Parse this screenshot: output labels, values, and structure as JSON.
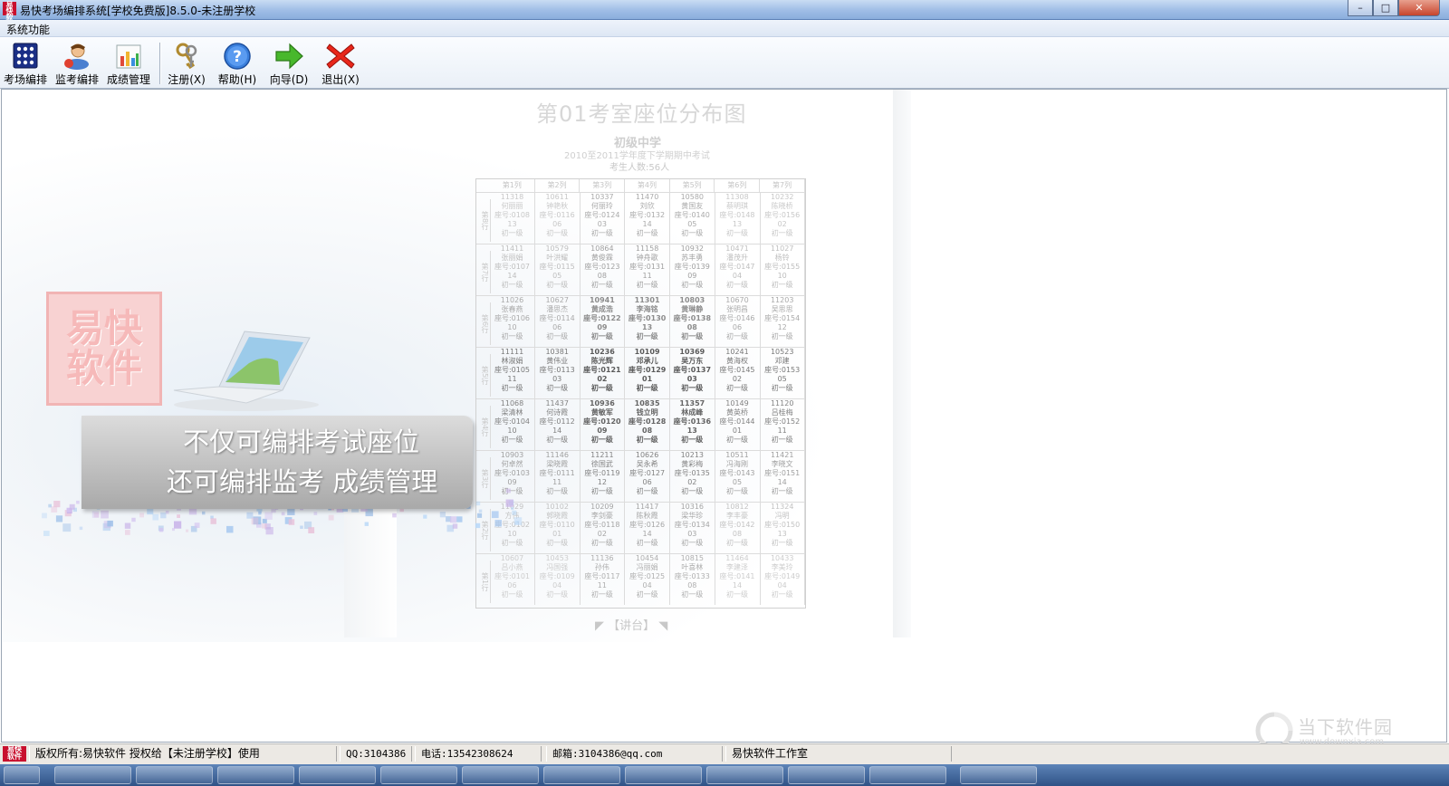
{
  "window": {
    "title": "易快考场编排系统[学校免费版]8.5.0-未注册学校",
    "app_icon_text": "易快软件",
    "controls": {
      "minimize": "–",
      "maximize": "□",
      "close": "✕"
    }
  },
  "menubar": {
    "items": [
      {
        "label": "系统功能"
      }
    ]
  },
  "toolbar": {
    "buttons": [
      {
        "label": "考场编排",
        "icon": "exam-grid-icon"
      },
      {
        "label": "监考编排",
        "icon": "proctor-person-icon"
      },
      {
        "label": "成绩管理",
        "icon": "bar-chart-icon"
      },
      {
        "label": "注册(X)",
        "icon": "keys-icon"
      },
      {
        "label": "帮助(H)",
        "icon": "help-icon"
      },
      {
        "label": "向导(D)",
        "icon": "green-arrow-icon"
      },
      {
        "label": "退出(X)",
        "icon": "red-x-icon"
      }
    ]
  },
  "splash": {
    "seating_chart": {
      "title": "第01考室座位分布图",
      "school": "初级中学",
      "exam": "2010至2011学年度下学期期中考试",
      "count": "考生人数:56人",
      "columns": [
        "第1列",
        "第2列",
        "第3列",
        "第4列",
        "第5列",
        "第6列",
        "第7列"
      ],
      "rows": [
        {
          "label": "第8行",
          "seats": [
            {
              "id": "11318",
              "name": "何丽丽",
              "seat": "座号:0108",
              "room": "13",
              "grade": "初一级"
            },
            {
              "id": "10611",
              "name": "钟艳秋",
              "seat": "座号:0116",
              "room": "06",
              "grade": "初一级"
            },
            {
              "id": "10337",
              "name": "何丽玲",
              "seat": "座号:0124",
              "room": "03",
              "grade": "初一级"
            },
            {
              "id": "11470",
              "name": "刘欣",
              "seat": "座号:0132",
              "room": "14",
              "grade": "初一级"
            },
            {
              "id": "10580",
              "name": "黄国友",
              "seat": "座号:0140",
              "room": "05",
              "grade": "初一级"
            },
            {
              "id": "11308",
              "name": "蔡明琪",
              "seat": "座号:0148",
              "room": "13",
              "grade": "初一级"
            },
            {
              "id": "10232",
              "name": "陈晓桥",
              "seat": "座号:0156",
              "room": "02",
              "grade": "初一级"
            }
          ]
        },
        {
          "label": "第7行",
          "seats": [
            {
              "id": "11411",
              "name": "张丽娟",
              "seat": "座号:0107",
              "room": "14",
              "grade": "初一级"
            },
            {
              "id": "10579",
              "name": "叶洪耀",
              "seat": "座号:0115",
              "room": "05",
              "grade": "初一级"
            },
            {
              "id": "10864",
              "name": "黄俊霖",
              "seat": "座号:0123",
              "room": "08",
              "grade": "初一级"
            },
            {
              "id": "11158",
              "name": "钟舟歌",
              "seat": "座号:0131",
              "room": "11",
              "grade": "初一级"
            },
            {
              "id": "10932",
              "name": "苏丰勇",
              "seat": "座号:0139",
              "room": "09",
              "grade": "初一级"
            },
            {
              "id": "10471",
              "name": "潘茂升",
              "seat": "座号:0147",
              "room": "04",
              "grade": "初一级"
            },
            {
              "id": "11027",
              "name": "杨铃",
              "seat": "座号:0155",
              "room": "10",
              "grade": "初一级"
            }
          ]
        },
        {
          "label": "第6行",
          "seats": [
            {
              "id": "11026",
              "name": "张春燕",
              "seat": "座号:0106",
              "room": "10",
              "grade": "初一级"
            },
            {
              "id": "10627",
              "name": "潘思杰",
              "seat": "座号:0114",
              "room": "06",
              "grade": "初一级"
            },
            {
              "id": "10941",
              "name": "黄成浩",
              "seat": "座号:0122",
              "room": "09",
              "grade": "初一级"
            },
            {
              "id": "11301",
              "name": "李海铭",
              "seat": "座号:0130",
              "room": "13",
              "grade": "初一级"
            },
            {
              "id": "10803",
              "name": "黄琳静",
              "seat": "座号:0138",
              "room": "08",
              "grade": "初一级"
            },
            {
              "id": "10670",
              "name": "张明昌",
              "seat": "座号:0146",
              "room": "06",
              "grade": "初一级"
            },
            {
              "id": "11203",
              "name": "吴思思",
              "seat": "座号:0154",
              "room": "12",
              "grade": "初一级"
            }
          ]
        },
        {
          "label": "第5行",
          "seats": [
            {
              "id": "11111",
              "name": "林淑娟",
              "seat": "座号:0105",
              "room": "11",
              "grade": "初一级"
            },
            {
              "id": "10381",
              "name": "黄伟业",
              "seat": "座号:0113",
              "room": "03",
              "grade": "初一级"
            },
            {
              "id": "10236",
              "name": "陈光辉",
              "seat": "座号:0121",
              "room": "02",
              "grade": "初一级"
            },
            {
              "id": "10109",
              "name": "邓承儿",
              "seat": "座号:0129",
              "room": "01",
              "grade": "初一级"
            },
            {
              "id": "10369",
              "name": "吴万东",
              "seat": "座号:0137",
              "room": "03",
              "grade": "初一级"
            },
            {
              "id": "10241",
              "name": "黄海权",
              "seat": "座号:0145",
              "room": "02",
              "grade": "初一级"
            },
            {
              "id": "10523",
              "name": "邓建",
              "seat": "座号:0153",
              "room": "05",
              "grade": "初一级"
            }
          ]
        },
        {
          "label": "第4行",
          "seats": [
            {
              "id": "11068",
              "name": "梁清林",
              "seat": "座号:0104",
              "room": "10",
              "grade": "初一级"
            },
            {
              "id": "11437",
              "name": "何诗霞",
              "seat": "座号:0112",
              "room": "14",
              "grade": "初一级"
            },
            {
              "id": "10936",
              "name": "黄敏军",
              "seat": "座号:0120",
              "room": "09",
              "grade": "初一级"
            },
            {
              "id": "10835",
              "name": "钱立明",
              "seat": "座号:0128",
              "room": "08",
              "grade": "初一级"
            },
            {
              "id": "11357",
              "name": "林成峰",
              "seat": "座号:0136",
              "room": "13",
              "grade": "初一级"
            },
            {
              "id": "10149",
              "name": "黄英桥",
              "seat": "座号:0144",
              "room": "01",
              "grade": "初一级"
            },
            {
              "id": "11120",
              "name": "吕桂梅",
              "seat": "座号:0152",
              "room": "11",
              "grade": "初一级"
            }
          ]
        },
        {
          "label": "第3行",
          "seats": [
            {
              "id": "10903",
              "name": "何卓然",
              "seat": "座号:0103",
              "room": "09",
              "grade": "初一级"
            },
            {
              "id": "11146",
              "name": "梁晓霞",
              "seat": "座号:0111",
              "room": "11",
              "grade": "初一级"
            },
            {
              "id": "11211",
              "name": "徐国武",
              "seat": "座号:0119",
              "room": "12",
              "grade": "初一级"
            },
            {
              "id": "10626",
              "name": "吴永希",
              "seat": "座号:0127",
              "room": "06",
              "grade": "初一级"
            },
            {
              "id": "10213",
              "name": "黄彩梅",
              "seat": "座号:0135",
              "room": "02",
              "grade": "初一级"
            },
            {
              "id": "10511",
              "name": "冯海刚",
              "seat": "座号:0143",
              "room": "05",
              "grade": "初一级"
            },
            {
              "id": "11421",
              "name": "李晓文",
              "seat": "座号:0151",
              "room": "14",
              "grade": "初一级"
            }
          ]
        },
        {
          "label": "第2行",
          "seats": [
            {
              "id": "11029",
              "name": "方伟",
              "seat": "座号:0102",
              "room": "10",
              "grade": "初一级"
            },
            {
              "id": "10102",
              "name": "郭晓霞",
              "seat": "座号:0110",
              "room": "01",
              "grade": "初一级"
            },
            {
              "id": "10209",
              "name": "李剑豪",
              "seat": "座号:0118",
              "room": "02",
              "grade": "初一级"
            },
            {
              "id": "11417",
              "name": "陈秋霞",
              "seat": "座号:0126",
              "room": "14",
              "grade": "初一级"
            },
            {
              "id": "10316",
              "name": "梁华珍",
              "seat": "座号:0134",
              "room": "03",
              "grade": "初一级"
            },
            {
              "id": "10812",
              "name": "李丰豪",
              "seat": "座号:0142",
              "room": "08",
              "grade": "初一级"
            },
            {
              "id": "11324",
              "name": "冯明",
              "seat": "座号:0150",
              "room": "13",
              "grade": "初一级"
            }
          ]
        },
        {
          "label": "第1行",
          "seats": [
            {
              "id": "10607",
              "name": "吕小燕",
              "seat": "座号:0101",
              "room": "06",
              "grade": "初一级"
            },
            {
              "id": "10453",
              "name": "冯国强",
              "seat": "座号:0109",
              "room": "04",
              "grade": "初一级"
            },
            {
              "id": "11136",
              "name": "孙伟",
              "seat": "座号:0117",
              "room": "11",
              "grade": "初一级"
            },
            {
              "id": "10454",
              "name": "冯丽娟",
              "seat": "座号:0125",
              "room": "04",
              "grade": "初一级"
            },
            {
              "id": "10815",
              "name": "叶喜林",
              "seat": "座号:0133",
              "room": "08",
              "grade": "初一级"
            },
            {
              "id": "11464",
              "name": "李建泽",
              "seat": "座号:0141",
              "room": "14",
              "grade": "初一级"
            },
            {
              "id": "10433",
              "name": "李美玲",
              "seat": "座号:0149",
              "room": "04",
              "grade": "初一级"
            }
          ]
        }
      ],
      "podium": "【讲台】"
    },
    "logo_text": "易快软件",
    "banner_line1": "不仅可编排考试座位",
    "banner_line2": "还可编排监考 成绩管理"
  },
  "watermark": {
    "name": "当下软件园",
    "url": "www.downxia.com"
  },
  "statusbar": {
    "icon_text": "易快软件",
    "copyright": "版权所有:易快软件 授权给【未注册学校】使用",
    "qq": "QQ:3104386",
    "phone": "电话:13542308624",
    "email": "邮箱:3104386@qq.com",
    "studio": "易快软件工作室"
  },
  "colors": {
    "brand_red": "#c8102e",
    "titlebar": "#9fbde6",
    "banner": "#b5b5b5"
  }
}
